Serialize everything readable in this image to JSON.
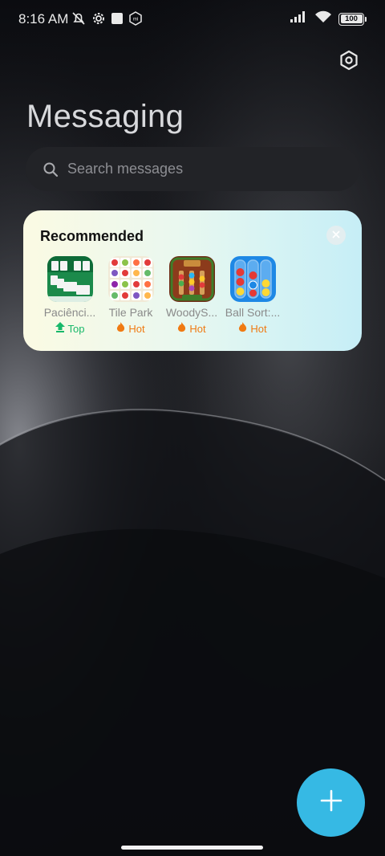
{
  "status": {
    "time": "8:16 AM",
    "battery": "100",
    "icons": [
      "mute-icon",
      "settings-cog-icon",
      "square-icon",
      "mi-icon",
      "shield-icon",
      "signal-icon",
      "wifi-icon",
      "battery-icon"
    ]
  },
  "header": {
    "title": "Messaging",
    "settings_icon": "settings-icon"
  },
  "search": {
    "placeholder": "Search messages"
  },
  "recommended": {
    "title": "Recommended",
    "apps": [
      {
        "name": "Paciênci...",
        "badge": "Top",
        "badge_type": "top"
      },
      {
        "name": "Tile Park",
        "badge": "Hot",
        "badge_type": "hot"
      },
      {
        "name": "WoodyS...",
        "badge": "Hot",
        "badge_type": "hot"
      },
      {
        "name": "Ball Sort:...",
        "badge": "Hot",
        "badge_type": "hot"
      }
    ]
  },
  "colors": {
    "accent": "#36b9e4",
    "top_badge": "#18b86a",
    "hot_badge": "#f07a12",
    "background": "#0b0c10"
  },
  "fab": {
    "icon": "plus-icon"
  }
}
